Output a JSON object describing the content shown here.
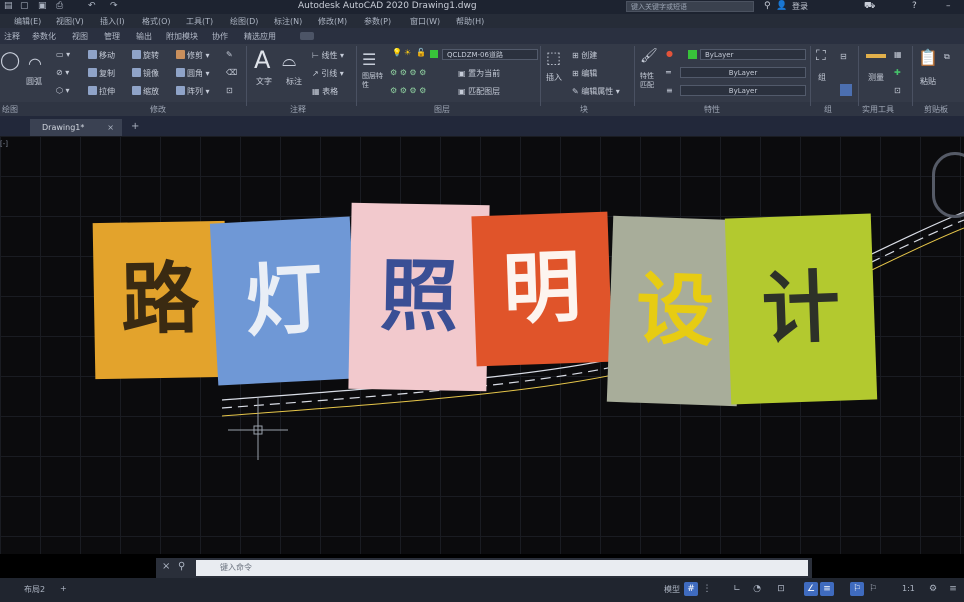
{
  "app": {
    "title": "Autodesk AutoCAD 2020    Drawing1.dwg",
    "search_placeholder": "键入关键字或短语",
    "login_label": "登录"
  },
  "menu": [
    "编辑(E)",
    "视图(V)",
    "插入(I)",
    "格式(O)",
    "工具(T)",
    "绘图(D)",
    "标注(N)",
    "修改(M)",
    "参数(P)",
    "窗口(W)",
    "帮助(H)"
  ],
  "ribbon_tabs": [
    "注释",
    "参数化",
    "视图",
    "管理",
    "输出",
    "附加模块",
    "协作",
    "精选应用"
  ],
  "ribbon": {
    "modify_buttons": [
      "移动",
      "旋转",
      "修剪",
      "复制",
      "镜像",
      "圆角",
      "拉伸",
      "缩放",
      "阵列"
    ],
    "text_label": "文字",
    "dim_label": "标注",
    "leader_label": "引线",
    "table_label": "表格",
    "layer_props_label": "图层特性",
    "layer_name": "QCLDZM-06道路",
    "layer_buttons": [
      "置为当前",
      "匹配图层"
    ],
    "insert_label": "插入",
    "block_buttons": [
      "创建",
      "编辑",
      "编辑属性"
    ],
    "match_props_label": "特性匹配",
    "bylayer_values": [
      "ByLayer",
      "ByLayer",
      "ByLayer"
    ],
    "group_label": "组",
    "measure_label": "测量",
    "paste_label": "粘贴",
    "panel_titles": [
      "绘图",
      "修改",
      "注释",
      "图层",
      "块",
      "特性",
      "组",
      "实用工具",
      "剪贴板"
    ]
  },
  "document_tab": "Drawing1*",
  "title_cards": [
    {
      "char": "路",
      "bg": "#e3a32c",
      "fg": "#3a2a12"
    },
    {
      "char": "灯",
      "bg": "#6f98d6",
      "fg": "#e9eef6"
    },
    {
      "char": "照",
      "bg": "#f2c9cd",
      "fg": "#3a4f95"
    },
    {
      "char": "明",
      "bg": "#e0542a",
      "fg": "#fdf4ef"
    },
    {
      "char": "设",
      "bg": "#a8ad9a",
      "fg": "#e7cc12"
    },
    {
      "char": "计",
      "bg": "#b3c92f",
      "fg": "#2d3128"
    }
  ],
  "command": {
    "placeholder": "键入命令"
  },
  "status": {
    "layout_tabs": [
      "布局2"
    ],
    "model_label": "模型",
    "scale_label": "1:1"
  },
  "colors": {
    "accent": "#3f6bbf",
    "ribbon_bg": "#343a48"
  }
}
